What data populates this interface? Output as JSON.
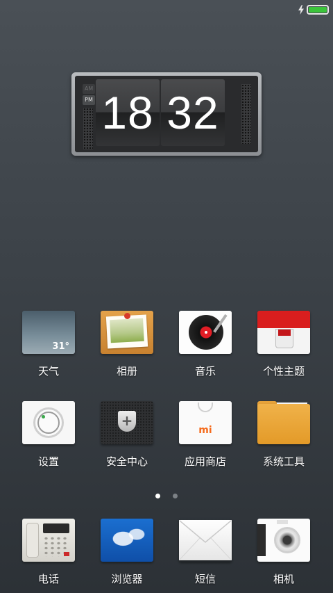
{
  "status_bar": {
    "charging_icon": "lightning-icon",
    "battery_level": 1.0,
    "battery_color": "#3bc43b"
  },
  "clock_widget": {
    "am_label": "AM",
    "pm_label": "PM",
    "active_period": "PM",
    "hours": "18",
    "minutes": "32"
  },
  "apps_row1": [
    {
      "label": "天气",
      "icon": "weather-icon",
      "temperature": "31°"
    },
    {
      "label": "相册",
      "icon": "gallery-icon"
    },
    {
      "label": "音乐",
      "icon": "music-icon"
    },
    {
      "label": "个性主题",
      "icon": "theme-icon"
    }
  ],
  "apps_row2": [
    {
      "label": "设置",
      "icon": "settings-icon"
    },
    {
      "label": "安全中心",
      "icon": "security-icon"
    },
    {
      "label": "应用商店",
      "icon": "app-store-icon",
      "logo_text": "mi"
    },
    {
      "label": "系统工具",
      "icon": "folder-icon"
    }
  ],
  "page_indicator": {
    "pages": 2,
    "current": 1
  },
  "dock": [
    {
      "label": "电话",
      "icon": "phone-icon"
    },
    {
      "label": "浏览器",
      "icon": "browser-icon"
    },
    {
      "label": "短信",
      "icon": "sms-icon"
    },
    {
      "label": "相机",
      "icon": "camera-icon"
    }
  ]
}
